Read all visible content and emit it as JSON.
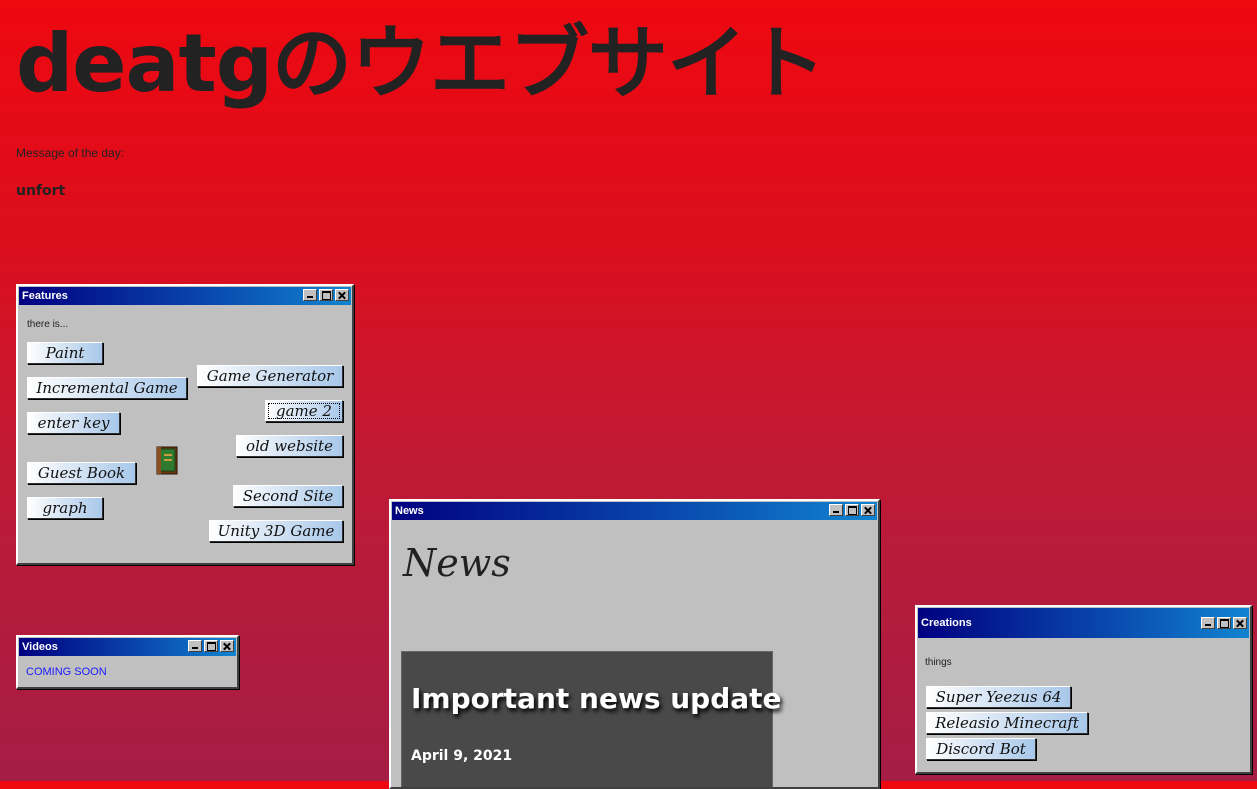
{
  "site": {
    "title": "deatgのウエブサイト",
    "motd_label": "Message of the day:",
    "motd_text": "unfort"
  },
  "features": {
    "title": "Features",
    "intro": "there is...",
    "buttons": {
      "paint": "Paint",
      "incremental": "Incremental Game",
      "enter_key": "enter key",
      "guest_book": "Guest Book",
      "graph": "graph",
      "game_generator": "Game Generator",
      "game2": "game 2",
      "old_website": "old website",
      "second_site": "Second Site",
      "unity": "Unity 3D Game"
    },
    "book_icon": "guest-book-icon"
  },
  "videos": {
    "title": "Videos",
    "text": "COMING SOON"
  },
  "news": {
    "title": "News",
    "heading": "News",
    "card_title": "Important news update",
    "card_date": "April 9, 2021"
  },
  "creations": {
    "title": "Creations",
    "intro": "things",
    "buttons": {
      "yeezus": "Super Yeezus 64",
      "minecraft": "Releasio Minecraft",
      "discord": "Discord Bot"
    }
  },
  "colors": {
    "background_top": "#ee0810",
    "background_bottom": "#a51d45",
    "window_face": "#c0c0c0",
    "titlebar_start": "#000080",
    "titlebar_end": "#1084d0"
  }
}
